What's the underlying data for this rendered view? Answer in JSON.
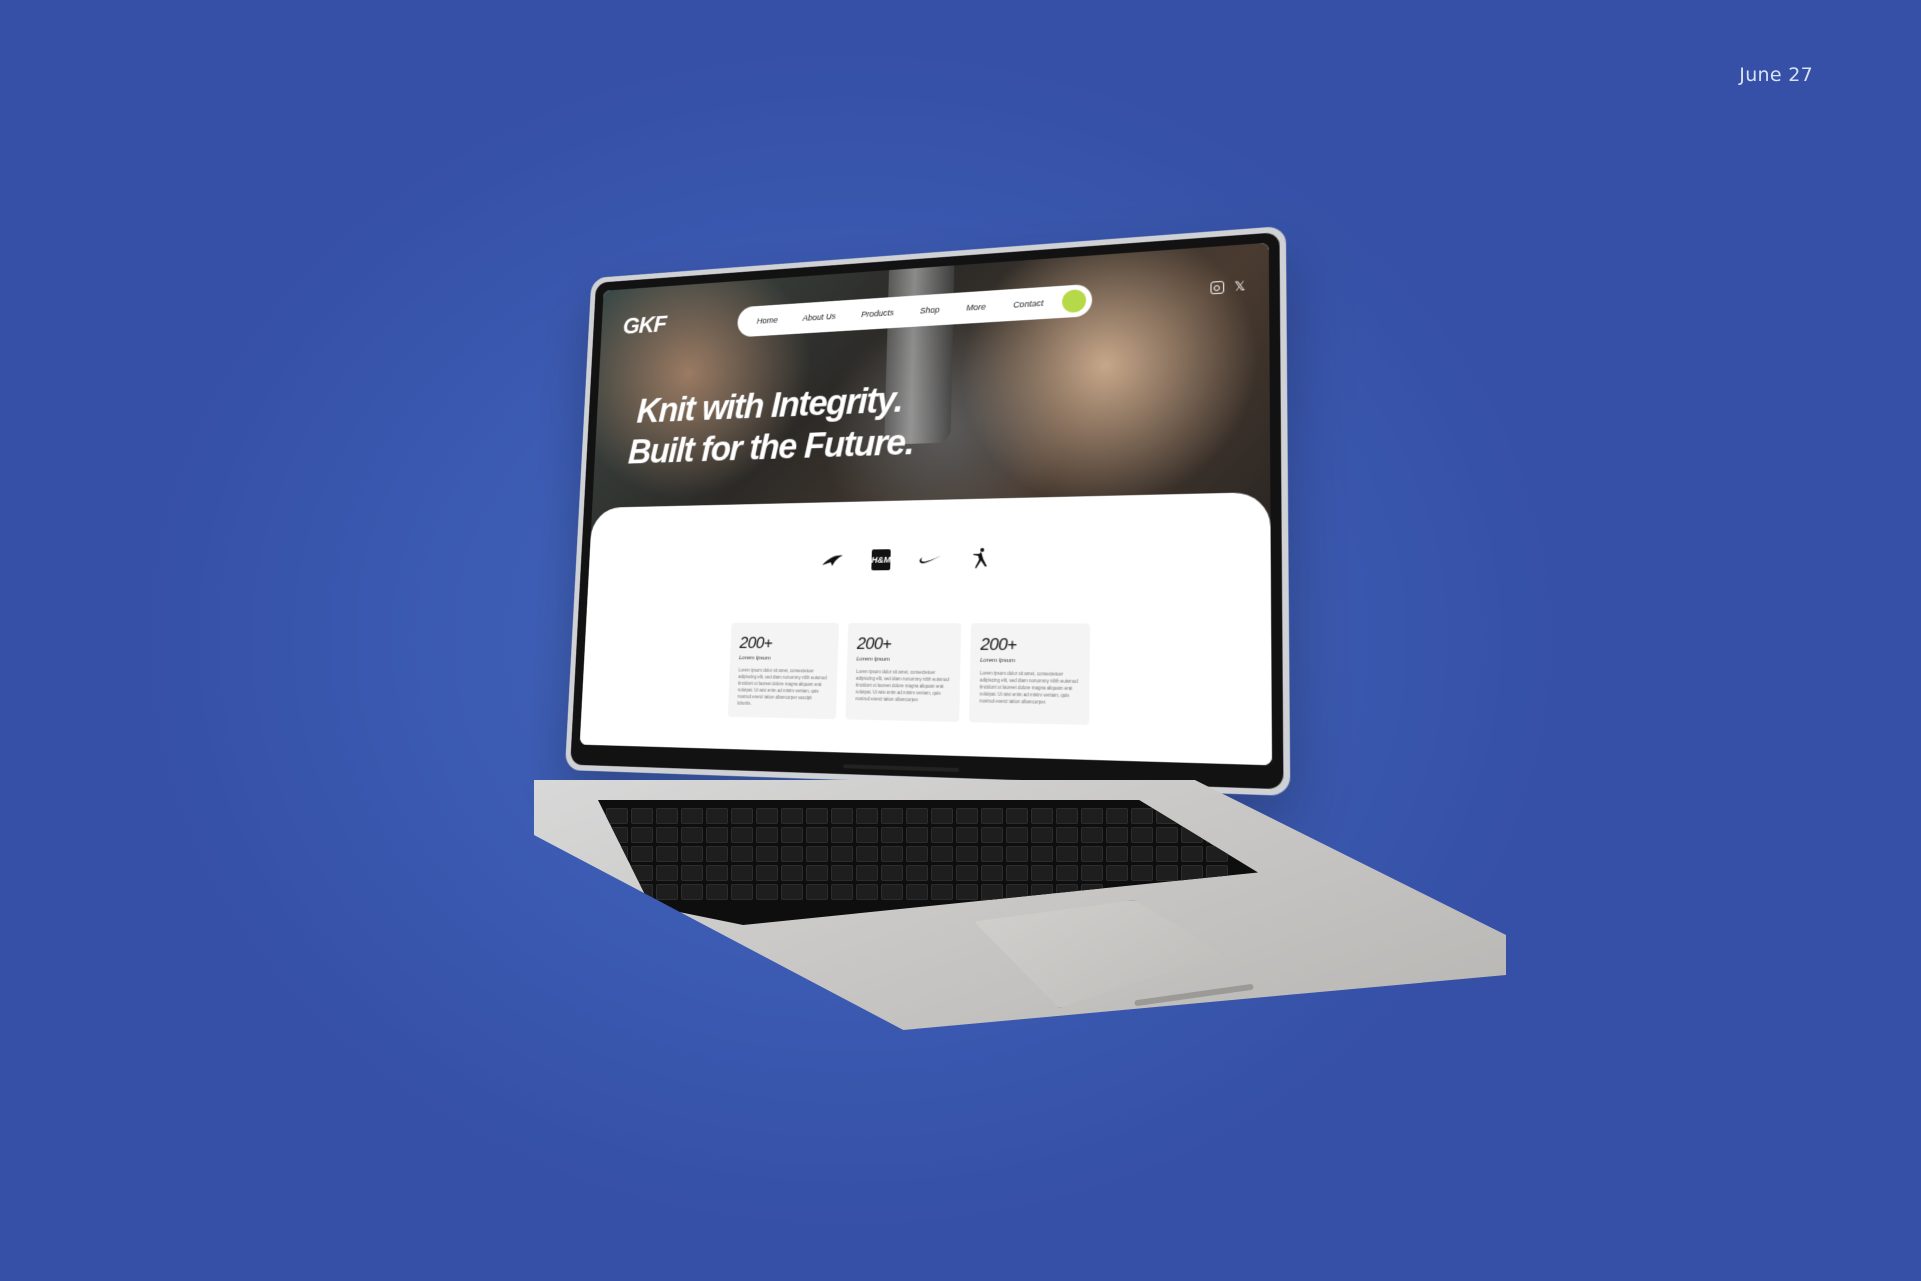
{
  "date": "June 27",
  "site": {
    "logo": "GKF",
    "nav": {
      "items": [
        "Home",
        "About Us",
        "Products",
        "Shop",
        "More",
        "Contact"
      ]
    },
    "hero": {
      "line1": "Knit with Integrity.",
      "line2": "Built for the Future."
    },
    "brands": [
      "mclaren-icon",
      "hm-icon",
      "nike-icon",
      "jordan-icon"
    ],
    "brand_hm_label": "H&M",
    "stats": [
      {
        "value": "200+",
        "label": "Lorem Ipsum",
        "text": "Lorem ipsum dolor sit amet, consectetuer adipiscing elit, sed diam nonummy nibh euismod tincidunt ut laoreet dolore magna aliquam erat volutpat. Ut wisi enim ad minim veniam, quis nostrud exerci tation ullamcorper suscipit lobortis."
      },
      {
        "value": "200+",
        "label": "Lorem Ipsum",
        "text": "Lorem ipsum dolor sit amet, consectetuer adipiscing elit, sed diam nonummy nibh euismod tincidunt ut laoreet dolore magna aliquam erat volutpat. Ut wisi enim ad minim veniam, quis nostrud exerci tation ullamcorper."
      },
      {
        "value": "200+",
        "label": "Lorem Ipsum",
        "text": "Lorem ipsum dolor sit amet, consectetuer adipiscing elit, sed diam nonummy nibh euismod tincidunt ut laoreet dolore magna aliquam erat volutpat. Ut wisi enim ad minim veniam, quis nostrud exerci tation ullamcorper."
      }
    ],
    "colors": {
      "background": "#3d5db5",
      "cta": "#b6d94a"
    }
  }
}
